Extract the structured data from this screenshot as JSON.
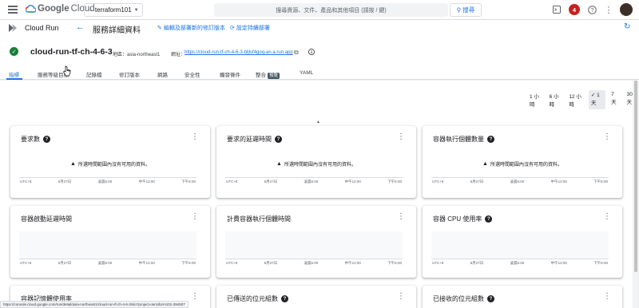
{
  "topbar": {
    "logo_google": "Google",
    "logo_cloud": "Cloud",
    "project": "terraform101",
    "search_placeholder": "搜尋資源、文件、產品和其他項目 (請按 / 鍵)",
    "search_button": "搜尋",
    "notifications": "4"
  },
  "header": {
    "product": "Cloud Run",
    "title": "服務詳細資料",
    "edit_link": "編輯及部署新的修訂版本",
    "cd_link": "設定持續部署"
  },
  "service": {
    "name": "cloud-run-tf-ch-4-6-3",
    "region_label": "地區：",
    "region": "asia-northeast1",
    "url_label": "網址：",
    "url": "https://cloud-run-tf-ch-4-6-3-bljlsf4goq-an.a.run.app"
  },
  "tabs": [
    {
      "label": "指標"
    },
    {
      "label": "服務等級目標"
    },
    {
      "label": "記錄檔"
    },
    {
      "label": "修訂版本"
    },
    {
      "label": "網路"
    },
    {
      "label": "安全性"
    },
    {
      "label": "觸發條件"
    },
    {
      "label": "整合",
      "badge": "預覽"
    },
    {
      "label": "YAML"
    }
  ],
  "ranges": [
    "1 小時",
    "6 小時",
    "12 小時",
    "1 天",
    "7 天",
    "30 天"
  ],
  "selected_range": "1 天",
  "nodata_text": "所選時間範圍內沒有可用的資料。",
  "xticks": [
    "UTC+8",
    "6月27日",
    "凌晨6:00",
    "中午12:00",
    "下午6:00"
  ],
  "cards": [
    {
      "title": "要求數"
    },
    {
      "title": "要求的延遲時間"
    },
    {
      "title": "容器執行個體數量"
    },
    {
      "title": "容器啟動延遲時間"
    },
    {
      "title": "計費容器執行個體時間"
    },
    {
      "title": "容器 CPU 使用率"
    },
    {
      "title": "容器記憶體使用率"
    },
    {
      "title": "已傳送的位元組數"
    },
    {
      "title": "已接收的位元組數"
    }
  ],
  "status_url": "https://console.cloud.google.com/run/detail/asia-northeast1/cloud-run-tf-ch-4-6-3/slo?project=terraform101-394507",
  "colors": {
    "accent": "#1a73e8",
    "ok": "#188038",
    "notif": "#c5221f"
  }
}
